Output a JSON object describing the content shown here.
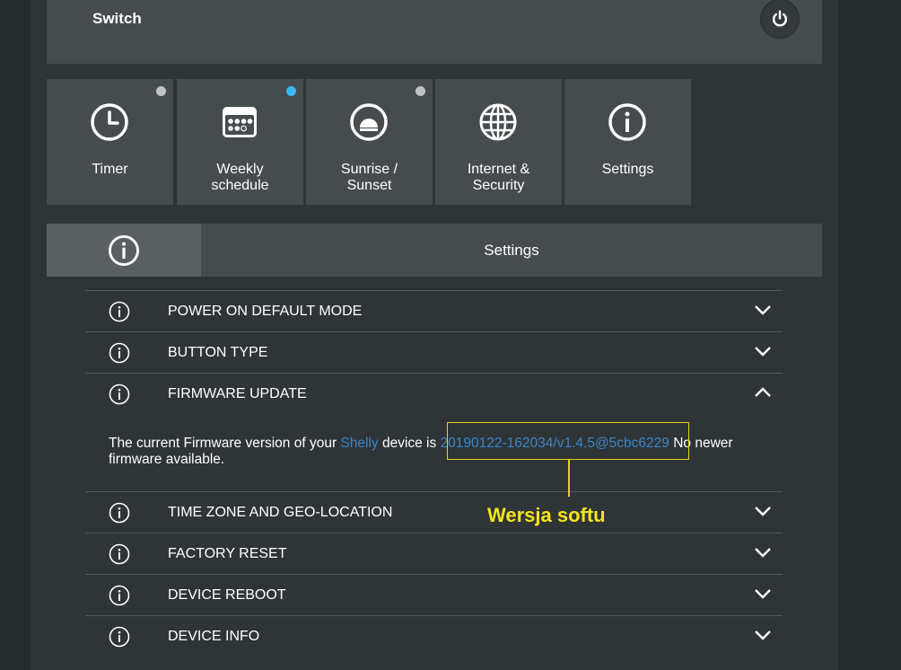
{
  "header": {
    "title": "Switch",
    "power_icon": "power-icon"
  },
  "tiles": [
    {
      "label": "Timer",
      "icon": "clock-icon",
      "indicator": "grey"
    },
    {
      "label": "Weekly\nschedule",
      "icon": "calendar-icon",
      "indicator": "blue"
    },
    {
      "label": "Sunrise /\nSunset",
      "icon": "sunrise-icon",
      "indicator": "grey"
    },
    {
      "label": "Internet &\nSecurity",
      "icon": "globe-icon",
      "indicator": "none"
    },
    {
      "label": "Settings",
      "icon": "info-icon",
      "indicator": "none"
    }
  ],
  "settings_bar": {
    "title": "Settings",
    "icon": "info-icon"
  },
  "rows": [
    {
      "label": "POWER ON DEFAULT MODE",
      "expanded": false
    },
    {
      "label": "BUTTON TYPE",
      "expanded": false
    },
    {
      "label": "FIRMWARE UPDATE",
      "expanded": true
    },
    {
      "label": "TIME ZONE AND GEO-LOCATION",
      "expanded": false
    },
    {
      "label": "FACTORY RESET",
      "expanded": false
    },
    {
      "label": "DEVICE REBOOT",
      "expanded": false
    },
    {
      "label": "DEVICE INFO",
      "expanded": false
    }
  ],
  "firmware": {
    "text_before": "The current Firmware version of your ",
    "brand": "Shelly",
    "text_middle": " device is ",
    "version": "20190122-162034/v1.4.5@5cbc6229",
    "text_after": " No newer firmware available."
  },
  "annotation": {
    "text": "Wersja softu",
    "color": "#e5d51c"
  },
  "colors": {
    "accent": "#3ab8f0",
    "link": "#3a86c8",
    "annotation": "#f3e41d"
  }
}
